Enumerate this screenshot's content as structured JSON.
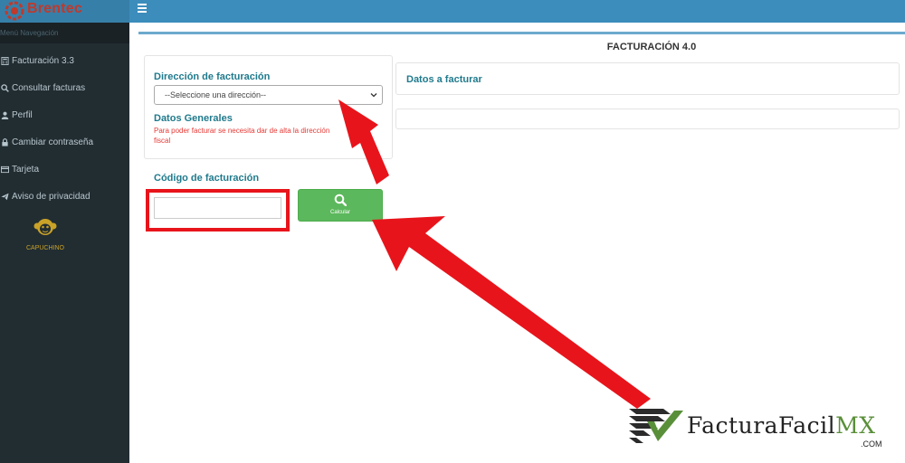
{
  "app": {
    "logo_text": "Brentec",
    "brand_color": "#c0392b"
  },
  "sidebar": {
    "header": "Menú Navegación",
    "items": [
      {
        "label": "Facturación 3.3",
        "icon": "calculator-icon"
      },
      {
        "label": "Consultar facturas",
        "icon": "search-icon"
      },
      {
        "label": "Perfil",
        "icon": "user-icon"
      },
      {
        "label": "Cambiar contraseña",
        "icon": "lock-icon"
      },
      {
        "label": "Tarjeta",
        "icon": "credit-card-icon"
      },
      {
        "label": "Aviso de privacidad",
        "icon": "paper-plane-icon"
      }
    ],
    "mascot_label": "CAPUCHINO"
  },
  "page": {
    "title": "FACTURACIÓN 4.0",
    "billing_address_label": "Dirección de facturación",
    "address_select_value": "--Seleccione una dirección--",
    "general_data_label": "Datos Generales",
    "warning_text": "Para poder facturar se necesita dar de alta la dirección\nfiscal",
    "data_to_invoice_label": "Datos a facturar",
    "billing_code_label": "Código de facturación",
    "billing_code_value": "",
    "calculate_label": "Calcular"
  },
  "watermark": {
    "text_main": "FacturaFacil",
    "text_accent": "MX",
    "suffix": ".COM"
  },
  "colors": {
    "topbar": "#3c8dbc",
    "sidebar": "#222d32",
    "accent_teal": "#1f7a8c",
    "warning": "#e53935",
    "button_green": "#5cb85c",
    "annotation_red": "#e8141b"
  }
}
